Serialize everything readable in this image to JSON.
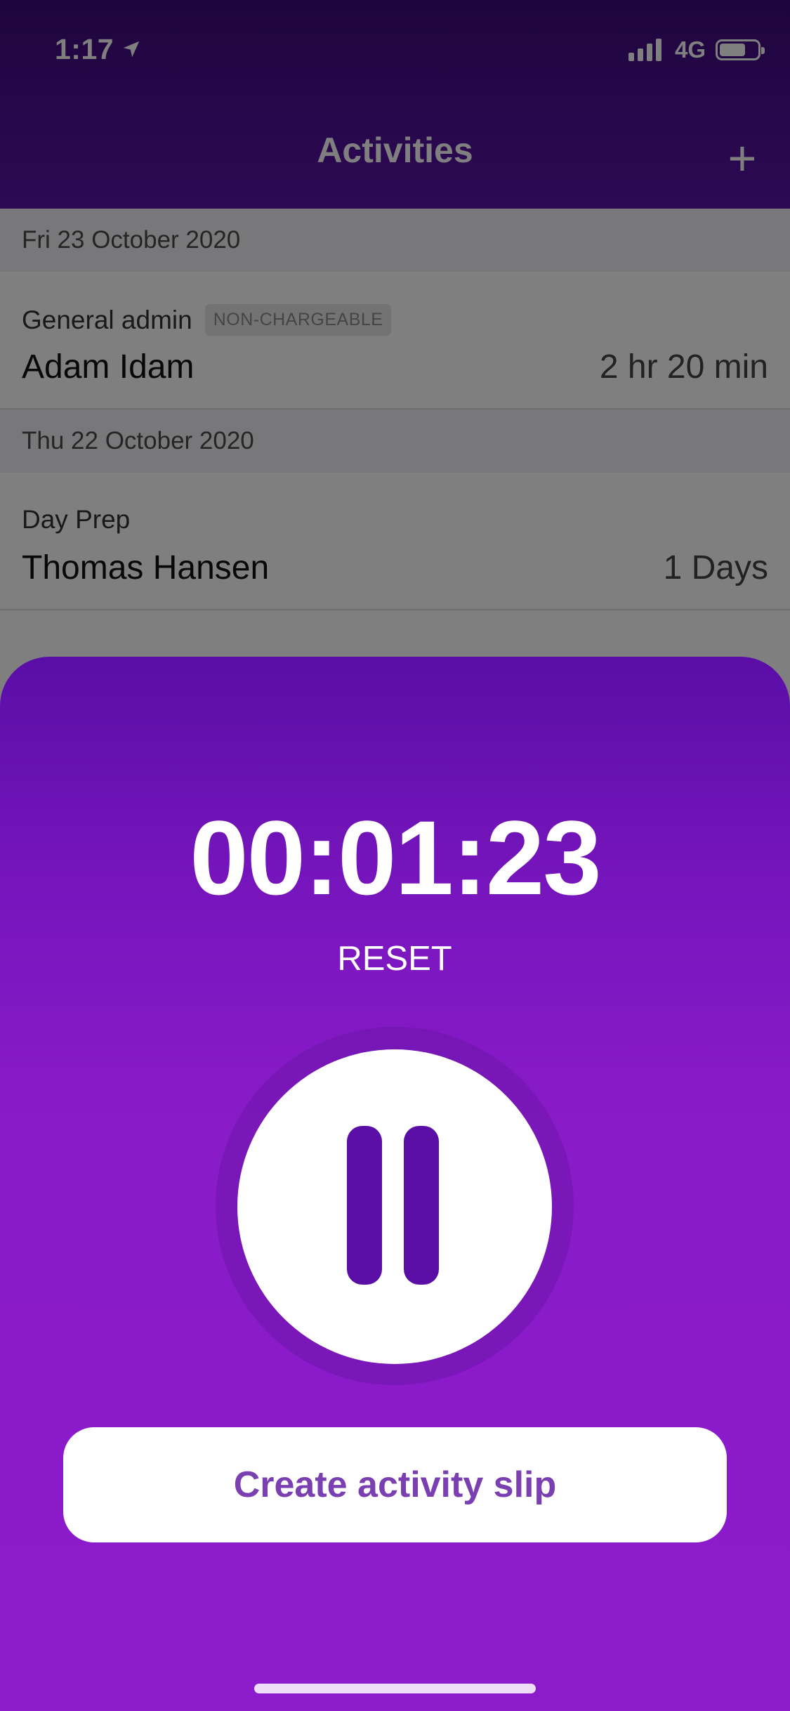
{
  "status_bar": {
    "time": "1:17",
    "network": "4G",
    "battery_level": 0.7
  },
  "nav": {
    "title": "Activities",
    "add_label": "+"
  },
  "sections": [
    {
      "date": "Fri 23 October 2020",
      "rows": [
        {
          "type": "General admin",
          "tag": "NON-CHARGEABLE",
          "name": "Adam Idam",
          "duration": "2 hr 20 min"
        }
      ]
    },
    {
      "date": "Thu 22 October 2020",
      "rows": [
        {
          "type": "Day Prep",
          "name": "Thomas Hansen",
          "duration": "1 Days"
        }
      ]
    }
  ],
  "timer": {
    "value": "00:01:23",
    "reset_label": "RESET",
    "create_label": "Create activity slip"
  },
  "colors": {
    "accent": "#8c1bcb",
    "accent_dark": "#5a0ea6",
    "button_text": "#7a3fb0"
  },
  "icons": {
    "location": "location-arrow-icon",
    "signal": "signal-bars-icon",
    "battery": "battery-icon",
    "add": "plus-icon",
    "pause": "pause-icon"
  }
}
